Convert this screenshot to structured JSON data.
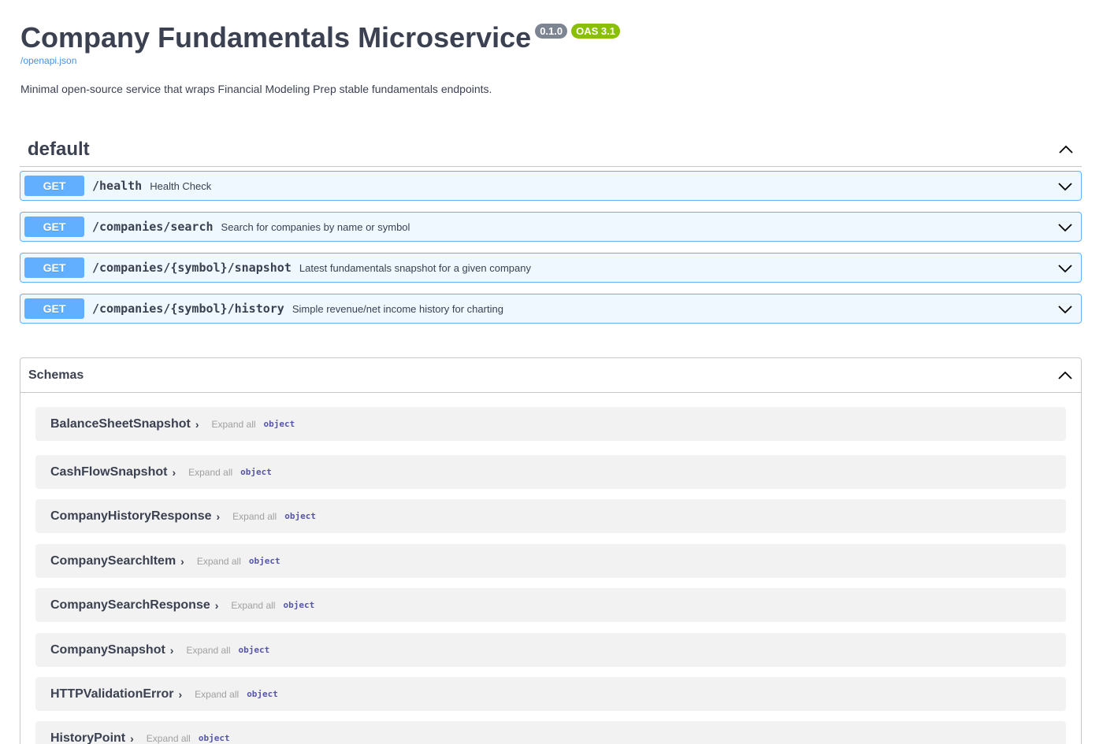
{
  "info": {
    "title": "Company Fundamentals Microservice",
    "version_badge": "0.1.0",
    "oas_badge": "OAS 3.1",
    "spec_link": "/openapi.json",
    "description": "Minimal open-source service that wraps Financial Modeling Prep stable fundamentals endpoints."
  },
  "tag": {
    "name": "default",
    "chevron_icon": "chevron-up-icon"
  },
  "operations": [
    {
      "method": "GET",
      "path": "/health",
      "summary": "Health Check"
    },
    {
      "method": "GET",
      "path": "/companies/search",
      "summary": "Search for companies by name or symbol"
    },
    {
      "method": "GET",
      "path": "/companies/{symbol}/snapshot",
      "summary": "Latest fundamentals snapshot for a given company"
    },
    {
      "method": "GET",
      "path": "/companies/{symbol}/history",
      "summary": "Simple revenue/net income history for charting"
    }
  ],
  "schemas": {
    "title": "Schemas",
    "expand_label": "Expand all",
    "items": [
      {
        "name": "BalanceSheetSnapshot",
        "type": "object"
      },
      {
        "name": "CashFlowSnapshot",
        "type": "object"
      },
      {
        "name": "CompanyHistoryResponse",
        "type": "object"
      },
      {
        "name": "CompanySearchItem",
        "type": "object"
      },
      {
        "name": "CompanySearchResponse",
        "type": "object"
      },
      {
        "name": "CompanySnapshot",
        "type": "object"
      },
      {
        "name": "HTTPValidationError",
        "type": "object"
      },
      {
        "name": "HistoryPoint",
        "type": "object"
      }
    ]
  },
  "colors": {
    "get_method": "#61affe",
    "text": "#3b4151",
    "version_badge": "#7d8492",
    "oas_badge": "#89bf04",
    "link": "#4990e2",
    "model_type": "#55a"
  }
}
